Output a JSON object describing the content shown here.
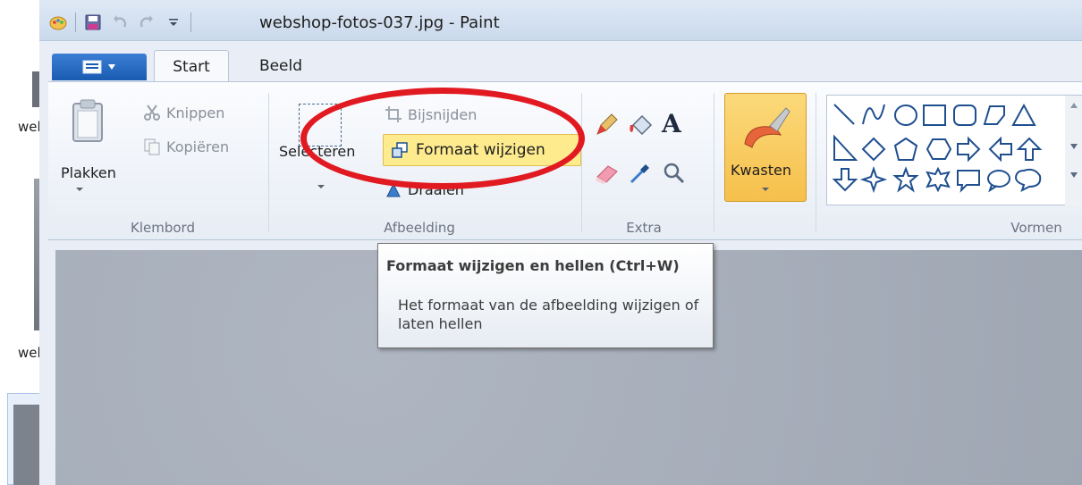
{
  "window": {
    "title": "webshop-fotos-037.jpg - Paint"
  },
  "tabs": {
    "start": "Start",
    "beeld": "Beeld"
  },
  "desktop": {
    "label1": "wel",
    "label2": "wel"
  },
  "clipboard": {
    "paste": "Plakken",
    "cut": "Knippen",
    "copy": "Kopiëren",
    "group": "Klembord"
  },
  "image": {
    "select": "Selecteren",
    "crop": "Bijsnijden",
    "resize": "Formaat wijzigen",
    "rotate": "Draaien",
    "group": "Afbeelding"
  },
  "tools": {
    "group": "Extra"
  },
  "brushes": {
    "label": "Kwasten"
  },
  "shapes": {
    "group": "Vormen"
  },
  "tooltip": {
    "title": "Formaat wijzigen en hellen (Ctrl+W)",
    "body": "Het formaat van de afbeelding wijzigen of laten hellen"
  },
  "colors": {
    "accent_red": "#e11a22",
    "ribbon_blue": "#1a5bb2",
    "highlight_yellow": "#fdeb8e"
  }
}
